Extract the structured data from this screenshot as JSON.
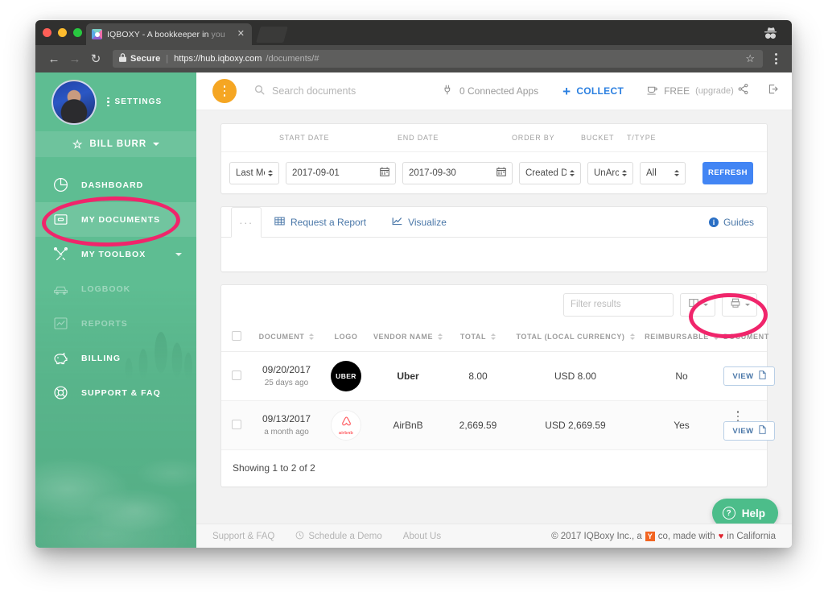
{
  "browser": {
    "tab_title_strong": "IQBOXY - A bookkeeper in ",
    "tab_title_dim": "you",
    "tab_close": "✕",
    "back": "←",
    "forward": "→",
    "reload": "↻",
    "lock_icon": "🔒",
    "secure_label": "Secure",
    "url_host": "https://hub.iqboxy.com",
    "url_path": "/documents/#",
    "bookmark_icon": "☆",
    "menu_icon": "kebab-menu-icon",
    "incognito_icon": "incognito-icon"
  },
  "sidebar": {
    "settings_label": "SETTINGS",
    "account_name": "BILL BURR",
    "nav": [
      {
        "label": "DASHBOARD",
        "icon": "pie-chart-icon",
        "state": "normal"
      },
      {
        "label": "MY DOCUMENTS",
        "icon": "inbox-icon",
        "state": "active"
      },
      {
        "label": "MY TOOLBOX",
        "icon": "tools-icon",
        "state": "normal",
        "caret": true
      },
      {
        "label": "LOGBOOK",
        "icon": "car-icon",
        "state": "disabled"
      },
      {
        "label": "REPORTS",
        "icon": "chart-line-icon",
        "state": "disabled"
      },
      {
        "label": "BILLING",
        "icon": "piggy-bank-icon",
        "state": "normal"
      },
      {
        "label": "SUPPORT & FAQ",
        "icon": "lifebuoy-icon",
        "state": "normal"
      }
    ]
  },
  "appbar": {
    "fab_icon": "more-options-icon",
    "search_placeholder": "Search documents",
    "connected_apps": "0 Connected Apps",
    "collect_label": "COLLECT",
    "collect_plus": "+",
    "plan_label": "FREE",
    "plan_upgrade": "(upgrade)",
    "share_icon": "share-icon",
    "logout_icon": "logout-icon"
  },
  "filters": {
    "labels": {
      "range": "",
      "start_date": "START DATE",
      "end_date": "END DATE",
      "order_by": "ORDER BY",
      "bucket": "BUCKET",
      "t_type": "T/TYPE"
    },
    "range_value": "Last Month",
    "start_date_value": "2017-09-01",
    "end_date_value": "2017-09-30",
    "order_by_value": "Created Date",
    "bucket_value": "UnArchived",
    "t_type_value": "All",
    "refresh_label": "REFRESH",
    "calendar_icon": "calendar-icon"
  },
  "tabs_card": {
    "more_label": "···",
    "request_report": "Request a Report",
    "visualize": "Visualize",
    "guides": "Guides",
    "info_glyph": "i"
  },
  "table": {
    "filter_placeholder": "Filter results",
    "columns_icon": "columns-toggle-icon",
    "export_icon": "export-print-icon",
    "headers": [
      {
        "label": "",
        "sort": false
      },
      {
        "label": "DOCUMENT",
        "sort": true
      },
      {
        "label": "LOGO",
        "sort": false
      },
      {
        "label": "VENDOR NAME",
        "sort": true
      },
      {
        "label": "TOTAL",
        "sort": true
      },
      {
        "label": "TOTAL (LOCAL CURRENCY)",
        "sort": true
      },
      {
        "label": "REIMBURSABLE",
        "sort": true
      },
      {
        "label": "DOCUMENT",
        "sort": false
      }
    ],
    "rows": [
      {
        "date": "09/20/2017",
        "relative": "25 days ago",
        "logo": "uber-logo",
        "logo_text": "UBER",
        "vendor": "Uber",
        "total": "8.00",
        "total_local": "USD 8.00",
        "reimbursable": "No",
        "has_kebab": false,
        "action_label": "VIEW"
      },
      {
        "date": "09/13/2017",
        "relative": "a month ago",
        "logo": "airbnb-logo",
        "logo_text": "airbnb",
        "vendor": "AirBnB",
        "total": "2,669.59",
        "total_local": "USD 2,669.59",
        "reimbursable": "Yes",
        "has_kebab": true,
        "action_label": "VIEW"
      }
    ],
    "showing": "Showing 1 to 2 of 2"
  },
  "footer": {
    "links": [
      "Support & FAQ",
      "Schedule a Demo",
      "About Us"
    ],
    "copyright_a": "© 2017 IQBoxy Inc., a",
    "yc": "Y",
    "copyright_b": "co, made with",
    "heart": "♥",
    "copyright_c": "in California"
  },
  "help_widget": {
    "label": "Help",
    "glyph": "?"
  },
  "colors": {
    "sidebar_green": "#5EBD92",
    "accent_blue": "#4285F4",
    "link_blue": "#4A77A8",
    "collect_blue": "#2A7FE0",
    "orange_fab": "#F5A623",
    "annotation_pink": "#F0256B",
    "help_green": "#4CBD8A",
    "airbnb_red": "#FF5A5F"
  }
}
